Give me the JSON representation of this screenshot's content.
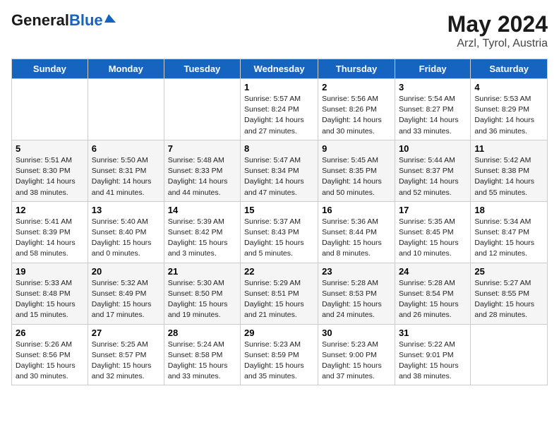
{
  "header": {
    "logo_general": "General",
    "logo_blue": "Blue",
    "month_year": "May 2024",
    "location": "Arzl, Tyrol, Austria"
  },
  "days_of_week": [
    "Sunday",
    "Monday",
    "Tuesday",
    "Wednesday",
    "Thursday",
    "Friday",
    "Saturday"
  ],
  "weeks": [
    [
      {
        "day": "",
        "info": ""
      },
      {
        "day": "",
        "info": ""
      },
      {
        "day": "",
        "info": ""
      },
      {
        "day": "1",
        "info": "Sunrise: 5:57 AM\nSunset: 8:24 PM\nDaylight: 14 hours and 27 minutes."
      },
      {
        "day": "2",
        "info": "Sunrise: 5:56 AM\nSunset: 8:26 PM\nDaylight: 14 hours and 30 minutes."
      },
      {
        "day": "3",
        "info": "Sunrise: 5:54 AM\nSunset: 8:27 PM\nDaylight: 14 hours and 33 minutes."
      },
      {
        "day": "4",
        "info": "Sunrise: 5:53 AM\nSunset: 8:29 PM\nDaylight: 14 hours and 36 minutes."
      }
    ],
    [
      {
        "day": "5",
        "info": "Sunrise: 5:51 AM\nSunset: 8:30 PM\nDaylight: 14 hours and 38 minutes."
      },
      {
        "day": "6",
        "info": "Sunrise: 5:50 AM\nSunset: 8:31 PM\nDaylight: 14 hours and 41 minutes."
      },
      {
        "day": "7",
        "info": "Sunrise: 5:48 AM\nSunset: 8:33 PM\nDaylight: 14 hours and 44 minutes."
      },
      {
        "day": "8",
        "info": "Sunrise: 5:47 AM\nSunset: 8:34 PM\nDaylight: 14 hours and 47 minutes."
      },
      {
        "day": "9",
        "info": "Sunrise: 5:45 AM\nSunset: 8:35 PM\nDaylight: 14 hours and 50 minutes."
      },
      {
        "day": "10",
        "info": "Sunrise: 5:44 AM\nSunset: 8:37 PM\nDaylight: 14 hours and 52 minutes."
      },
      {
        "day": "11",
        "info": "Sunrise: 5:42 AM\nSunset: 8:38 PM\nDaylight: 14 hours and 55 minutes."
      }
    ],
    [
      {
        "day": "12",
        "info": "Sunrise: 5:41 AM\nSunset: 8:39 PM\nDaylight: 14 hours and 58 minutes."
      },
      {
        "day": "13",
        "info": "Sunrise: 5:40 AM\nSunset: 8:40 PM\nDaylight: 15 hours and 0 minutes."
      },
      {
        "day": "14",
        "info": "Sunrise: 5:39 AM\nSunset: 8:42 PM\nDaylight: 15 hours and 3 minutes."
      },
      {
        "day": "15",
        "info": "Sunrise: 5:37 AM\nSunset: 8:43 PM\nDaylight: 15 hours and 5 minutes."
      },
      {
        "day": "16",
        "info": "Sunrise: 5:36 AM\nSunset: 8:44 PM\nDaylight: 15 hours and 8 minutes."
      },
      {
        "day": "17",
        "info": "Sunrise: 5:35 AM\nSunset: 8:45 PM\nDaylight: 15 hours and 10 minutes."
      },
      {
        "day": "18",
        "info": "Sunrise: 5:34 AM\nSunset: 8:47 PM\nDaylight: 15 hours and 12 minutes."
      }
    ],
    [
      {
        "day": "19",
        "info": "Sunrise: 5:33 AM\nSunset: 8:48 PM\nDaylight: 15 hours and 15 minutes."
      },
      {
        "day": "20",
        "info": "Sunrise: 5:32 AM\nSunset: 8:49 PM\nDaylight: 15 hours and 17 minutes."
      },
      {
        "day": "21",
        "info": "Sunrise: 5:30 AM\nSunset: 8:50 PM\nDaylight: 15 hours and 19 minutes."
      },
      {
        "day": "22",
        "info": "Sunrise: 5:29 AM\nSunset: 8:51 PM\nDaylight: 15 hours and 21 minutes."
      },
      {
        "day": "23",
        "info": "Sunrise: 5:28 AM\nSunset: 8:53 PM\nDaylight: 15 hours and 24 minutes."
      },
      {
        "day": "24",
        "info": "Sunrise: 5:28 AM\nSunset: 8:54 PM\nDaylight: 15 hours and 26 minutes."
      },
      {
        "day": "25",
        "info": "Sunrise: 5:27 AM\nSunset: 8:55 PM\nDaylight: 15 hours and 28 minutes."
      }
    ],
    [
      {
        "day": "26",
        "info": "Sunrise: 5:26 AM\nSunset: 8:56 PM\nDaylight: 15 hours and 30 minutes."
      },
      {
        "day": "27",
        "info": "Sunrise: 5:25 AM\nSunset: 8:57 PM\nDaylight: 15 hours and 32 minutes."
      },
      {
        "day": "28",
        "info": "Sunrise: 5:24 AM\nSunset: 8:58 PM\nDaylight: 15 hours and 33 minutes."
      },
      {
        "day": "29",
        "info": "Sunrise: 5:23 AM\nSunset: 8:59 PM\nDaylight: 15 hours and 35 minutes."
      },
      {
        "day": "30",
        "info": "Sunrise: 5:23 AM\nSunset: 9:00 PM\nDaylight: 15 hours and 37 minutes."
      },
      {
        "day": "31",
        "info": "Sunrise: 5:22 AM\nSunset: 9:01 PM\nDaylight: 15 hours and 38 minutes."
      },
      {
        "day": "",
        "info": ""
      }
    ]
  ]
}
